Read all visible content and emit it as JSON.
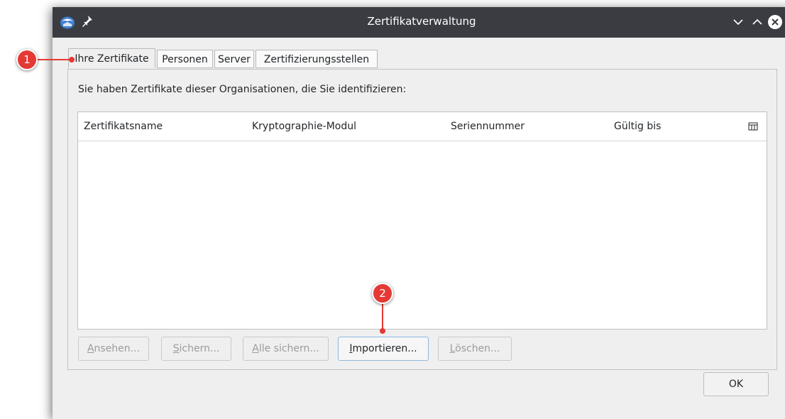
{
  "window": {
    "title": "Zertifikatverwaltung",
    "icons": {
      "app": "thunderbird-icon",
      "pin": "pin-icon",
      "minimize": "chevron-down-icon",
      "maximize": "chevron-up-icon",
      "close": "close-icon"
    }
  },
  "tabs": [
    {
      "label": "Ihre Zertifikate",
      "active": true
    },
    {
      "label": "Personen",
      "active": false
    },
    {
      "label": "Server",
      "active": false
    },
    {
      "label": "Zertifizierungsstellen",
      "active": false
    }
  ],
  "panel": {
    "description": "Sie haben Zertifikate dieser Organisationen, die Sie identifizieren:",
    "columns": [
      "Zertifikatsname",
      "Kryptographie-Modul",
      "Seriennummer",
      "Gültig bis"
    ],
    "rows": []
  },
  "buttons": [
    {
      "mnemonic": "A",
      "rest": "nsehen...",
      "enabled": false
    },
    {
      "mnemonic": "S",
      "rest": "ichern...",
      "enabled": false
    },
    {
      "mnemonic": "A",
      "rest": "lle sichern...",
      "enabled": false
    },
    {
      "mnemonic": "I",
      "rest": "mportieren...",
      "enabled": true
    },
    {
      "mnemonic": "L",
      "rest": "öschen...",
      "enabled": false
    }
  ],
  "ok_label": "OK",
  "callouts": [
    {
      "number": "1",
      "target": "Ihre Zertifikate"
    },
    {
      "number": "2",
      "target": "Importieren..."
    }
  ],
  "colors": {
    "titlebar": "#3a3c42",
    "callout": "#e53935",
    "focus_border": "#8fb8dc",
    "background": "#efefef"
  }
}
